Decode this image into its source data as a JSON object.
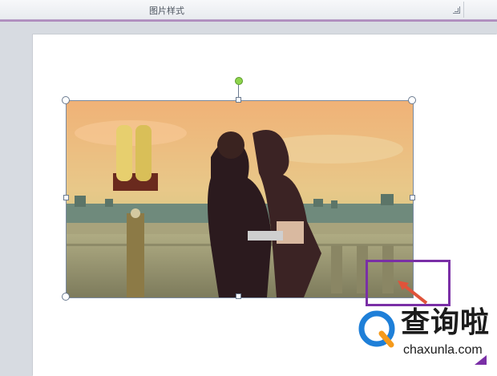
{
  "ribbon": {
    "group_label": "图片样式",
    "launcher_icon": "dialog-launcher-icon"
  },
  "picture": {
    "description_icon": "photo",
    "selected": true
  },
  "watermark": {
    "title": "查询啦",
    "url": "chaxunla.com",
    "logo_icon": "magnifier-q-logo-icon",
    "accent_color": "#7a2fa6",
    "logo_color": "#1e7fd8"
  }
}
